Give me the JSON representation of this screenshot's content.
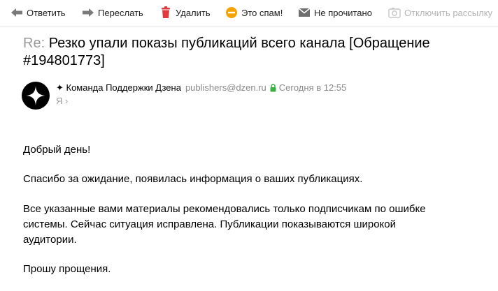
{
  "toolbar": {
    "reply_label": "Ответить",
    "forward_label": "Переслать",
    "delete_label": "Удалить",
    "spam_label": "Это спам!",
    "unread_label": "Не прочитано",
    "unsubscribe_label": "Отключить рассылку"
  },
  "message": {
    "subject_prefix": "Re:",
    "subject": "Резко упали показы публикаций всего канала  [Обращение #194801773]",
    "sender_name": "✦ Команда Поддержки Дзена",
    "sender_email": "publishers@dzen.ru",
    "date": "Сегодня в 12:55",
    "recipient": "Я ›",
    "body": {
      "greeting": "Добрый день!",
      "p1": "Спасибо за ожидание, появилась информация о ваших публикациях.",
      "p2_line1": "Все указанные вами материалы рекомендовались только подписчикам по ошибке",
      "p2_line2": "системы. Сейчас ситуация исправлена. Публикации показываются широкой",
      "p2_line3": "аудитории.",
      "closing": "Прошу прощения."
    }
  },
  "colors": {
    "delete_icon": "#e0393e",
    "spam_icon": "#f5a300",
    "lock_icon": "#3cb043",
    "muted_text": "#8a8a8a"
  },
  "icons": {
    "reply": "reply-arrow-icon",
    "forward": "forward-arrow-icon",
    "delete": "trash-icon",
    "spam": "spam-icon",
    "unread": "envelope-icon",
    "unsubscribe": "unsubscribe-icon",
    "avatar": "dzen-star-logo",
    "lock": "lock-icon"
  }
}
